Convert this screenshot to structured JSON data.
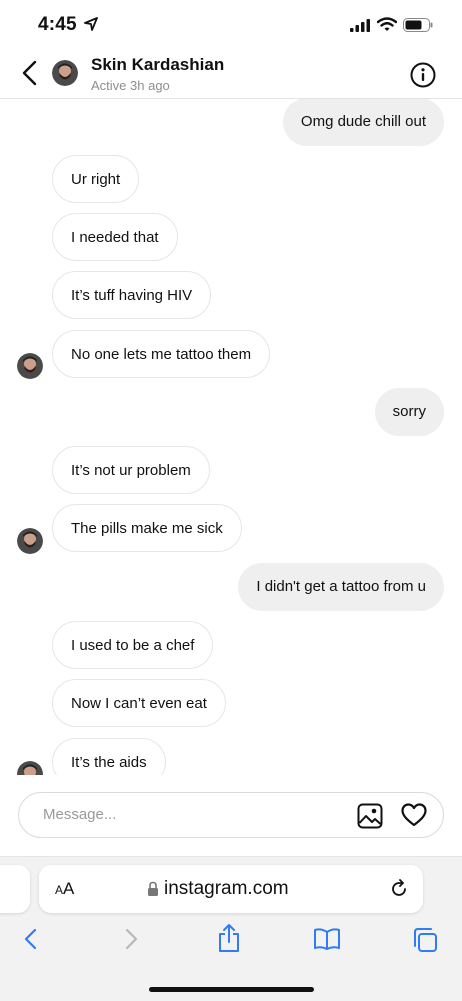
{
  "status_bar": {
    "time": "4:45"
  },
  "header": {
    "name": "Skin Kardashian",
    "status": "Active 3h ago"
  },
  "messages": [
    {
      "sender": "me",
      "text": "Omg dude chill out"
    },
    {
      "sender": "them",
      "text": "Ur right"
    },
    {
      "sender": "them",
      "text": "I needed that"
    },
    {
      "sender": "them",
      "text": "It’s tuff having HIV"
    },
    {
      "sender": "them",
      "text": "No one lets me tattoo them"
    },
    {
      "sender": "me",
      "text": "sorry"
    },
    {
      "sender": "them",
      "text": "It’s not ur problem"
    },
    {
      "sender": "them",
      "text": "The pills make me sick"
    },
    {
      "sender": "me",
      "text": "I didn't get a tattoo from u"
    },
    {
      "sender": "them",
      "text": "I used to be a chef"
    },
    {
      "sender": "them",
      "text": "Now I can’t even eat"
    },
    {
      "sender": "them",
      "text": "It’s the aids"
    }
  ],
  "composer": {
    "placeholder": "Message..."
  },
  "browser": {
    "text_size_label_small": "A",
    "text_size_label_large": "A",
    "url": "instagram.com"
  },
  "icons": {
    "back": "chevron-left-icon",
    "info": "info-icon",
    "gallery": "image-icon",
    "heart": "heart-icon",
    "lock": "lock-icon",
    "reload": "reload-icon",
    "browser_back": "chevron-left-icon",
    "browser_forward": "chevron-right-icon",
    "share": "share-icon",
    "bookmarks": "book-icon",
    "tabs": "tabs-icon"
  },
  "colors": {
    "browser_accent": "#2f7cf6",
    "outgoing_bubble": "#efefef",
    "incoming_border": "#e6e6e6"
  }
}
